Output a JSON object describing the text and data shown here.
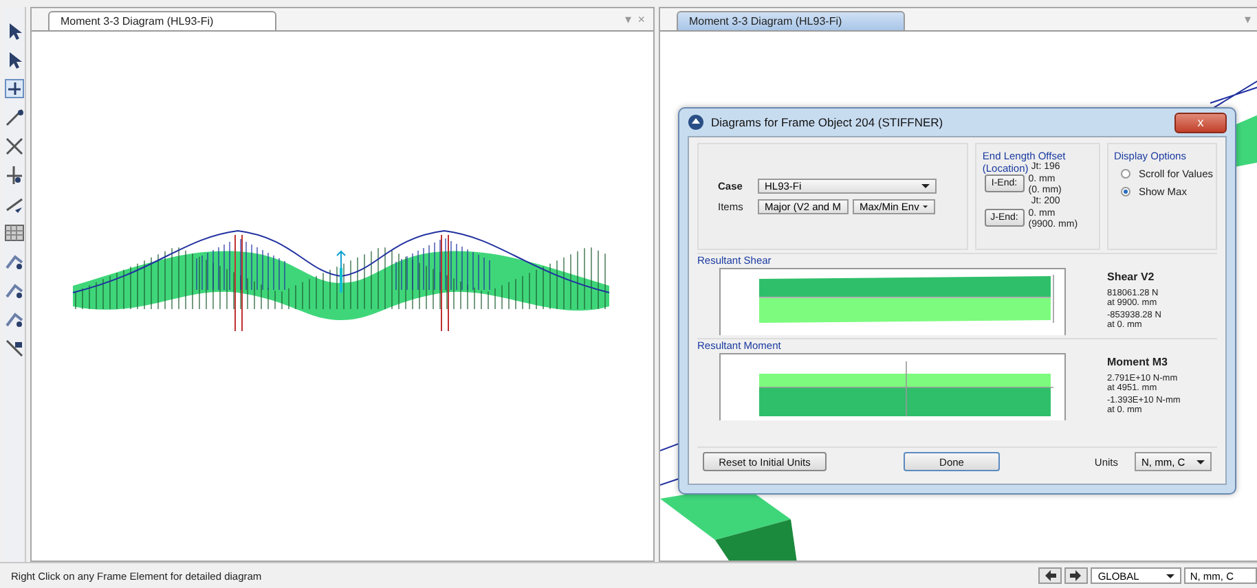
{
  "panes": [
    {
      "tab": {
        "label": "Moment 3-3 Diagram (HL93-Fi)",
        "selected": false
      },
      "controls": [
        "▾",
        "×"
      ]
    },
    {
      "tab": {
        "label": "Moment 3-3 Diagram (HL93-Fi)",
        "selected": true
      },
      "controls": [
        "▾"
      ]
    }
  ],
  "dialog": {
    "title": "Diagrams for Frame Object 204  (STIFFNER)",
    "close": "x",
    "case": {
      "label": "Case",
      "value": "HL93-Fi"
    },
    "items": {
      "label": "Items",
      "component": "Major (V2 and M",
      "type": "Max/Min Env"
    },
    "end_offset": {
      "title": "End Length Offset",
      "subtitle": "(Location)",
      "ends": [
        {
          "button": "I-End:",
          "joint": "Jt:  196",
          "offset": "0. mm",
          "location": "(0. mm)"
        },
        {
          "button": "J-End:",
          "joint": "Jt:  200",
          "offset": "0. mm",
          "location": "(9900. mm)"
        }
      ]
    },
    "display_options": {
      "title": "Display Options",
      "options": [
        {
          "label": "Scroll for Values",
          "selected": false
        },
        {
          "label": "Show Max",
          "selected": true
        }
      ]
    },
    "results": [
      {
        "kind": "shear",
        "label": "Resultant Shear",
        "title": "Shear V2",
        "lines": [
          "818061.28 N",
          "at 9900. mm",
          "-853938.28 N",
          "at 0. mm"
        ]
      },
      {
        "kind": "moment",
        "label": "Resultant Moment",
        "title": "Moment M3",
        "lines": [
          "2.791E+10 N-mm",
          "at 4951. mm",
          "-1.393E+10 N-mm",
          "at 0. mm"
        ]
      }
    ],
    "reset_button": "Reset to Initial Units",
    "done_button": "Done",
    "units": {
      "label": "Units",
      "value": "N, mm, C"
    }
  },
  "status_bar": {
    "message": "Right Click on any Frame Element for detailed diagram",
    "coord_system": "GLOBAL",
    "units": "N, mm, C"
  }
}
